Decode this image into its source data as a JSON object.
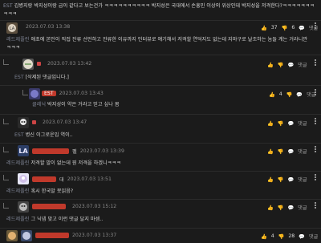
{
  "intro": {
    "prefix": "EST",
    "text": "김병지랑 박지성이랑 급이 같다고 보는건가 ㅋㅋㅋㅋㅋㅋㅋㅋㅋㅋ 박지성은 국대에서 손흥민 이상의 위상인데 박지성을 저격한다?ㅋㅋㅋㅋㅋㅋㅋㅋㅋㅋ"
  },
  "comments": [
    {
      "nick": "",
      "time": "2023.07.03 13:38",
      "prefix": "레드제플린",
      "text": "애초에 본인이 직접 잔류 선언하고 잔류한 이유까지 인터뷰로 얘기해서 저격할 연덕지도 없는데 지마구로 날조하는 놈들 계는 거라니깐ㅋㅋㅋ",
      "likes": "37",
      "dislikes": "6",
      "reply_label": "댓글"
    },
    {
      "nick": "",
      "time": "2023.07.03 13:42",
      "prefix": "EST",
      "text": "[삭제된 댓글입니다.]",
      "likes": "",
      "dislikes": "",
      "reply_label": "댓글"
    },
    {
      "nick": "EST",
      "time": "2023.07.03 13:43",
      "prefix": "클레닉",
      "text": "박지성이 약은 거라고 믿고 싶나 봄",
      "likes": "4",
      "dislikes": "",
      "reply_label": "댓글"
    },
    {
      "nick": "",
      "time": "2023.07.03 13:47",
      "prefix": "EST",
      "text": "병신 이그로운임 역이..",
      "likes": "",
      "dislikes": "",
      "reply_label": "댓글"
    },
    {
      "nick": "펠",
      "time": "2023.07.03 13:39",
      "prefix": "레드제플린",
      "text": "저격할 말이 없는데 뭔 저격을 하겠니ㅋㅋㅋ",
      "likes": "",
      "dislikes": "",
      "reply_label": "댓글"
    },
    {
      "nick": "대",
      "time": "2023.07.03 13:51",
      "prefix": "레드제플린",
      "text": "혹시 한국말 못읽음?",
      "likes": "",
      "dislikes": "",
      "reply_label": "댓글"
    },
    {
      "nick": "",
      "time": "2023.07.03 15:12",
      "prefix": "레드제플린",
      "text": "그 닉넴 맞고 이런 댓글 달지 마셈..",
      "likes": "",
      "dislikes": "",
      "reply_label": "댓글"
    },
    {
      "nick": "",
      "time": "2023.07.03 13:37",
      "prefix": "",
      "text": "",
      "likes": "4",
      "dislikes": "28",
      "reply_label": "댓글"
    }
  ],
  "colors": {
    "like": "#e8a63a",
    "dislike": "#9a9a9a",
    "pill": "#c0392b"
  }
}
